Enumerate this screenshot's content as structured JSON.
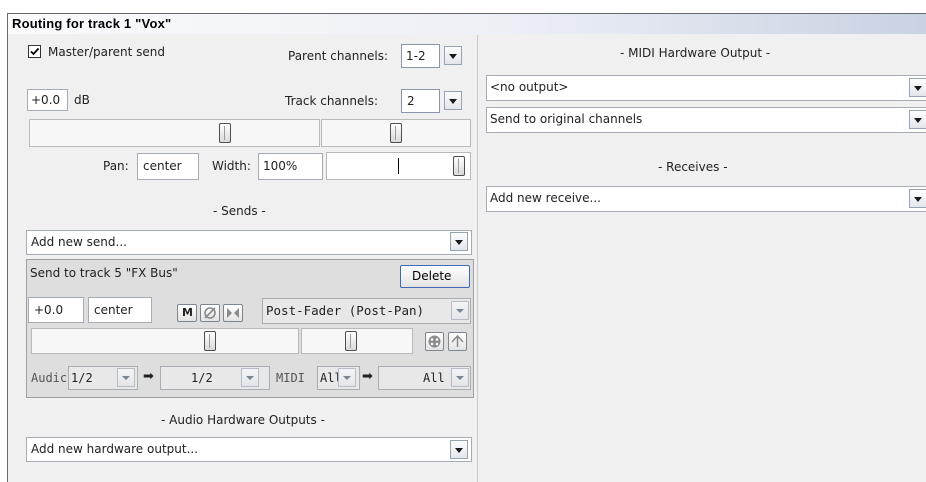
{
  "window": {
    "title": "Routing for track 1 \"Vox\""
  },
  "master": {
    "checked": true,
    "checkbox_label": "Master/parent send",
    "parent_channels_label": "Parent channels:",
    "parent_channels_value": "1-2",
    "volume_value": "+0.0",
    "volume_unit": "dB",
    "track_channels_label": "Track channels:",
    "track_channels_value": "2",
    "pan_label": "Pan:",
    "pan_value": "center",
    "width_label": "Width:",
    "width_value": "100%"
  },
  "sends": {
    "section_label": "- Sends -",
    "add_placeholder": "Add new send...",
    "send1": {
      "title": "Send to track 5 \"FX Bus\"",
      "delete_label": "Delete",
      "volume": "+0.0",
      "pan": "center",
      "mute_label": "M",
      "mode": "Post-Fader (Post-Pan)",
      "audio_label": "Audic",
      "audio_src": "1/2",
      "audio_dst": "1/2",
      "midi_label": "MIDI",
      "midi_src": "All",
      "midi_dst": "All",
      "arrow": "➡"
    }
  },
  "audio_hw": {
    "section_label": "- Audio Hardware Outputs -",
    "add_placeholder": "Add new hardware output..."
  },
  "midi_hw": {
    "section_label": "- MIDI Hardware Output -",
    "output_value": "<no output>",
    "channel_value": "Send to original channels"
  },
  "receives": {
    "section_label": "- Receives -",
    "add_placeholder": "Add new receive..."
  }
}
